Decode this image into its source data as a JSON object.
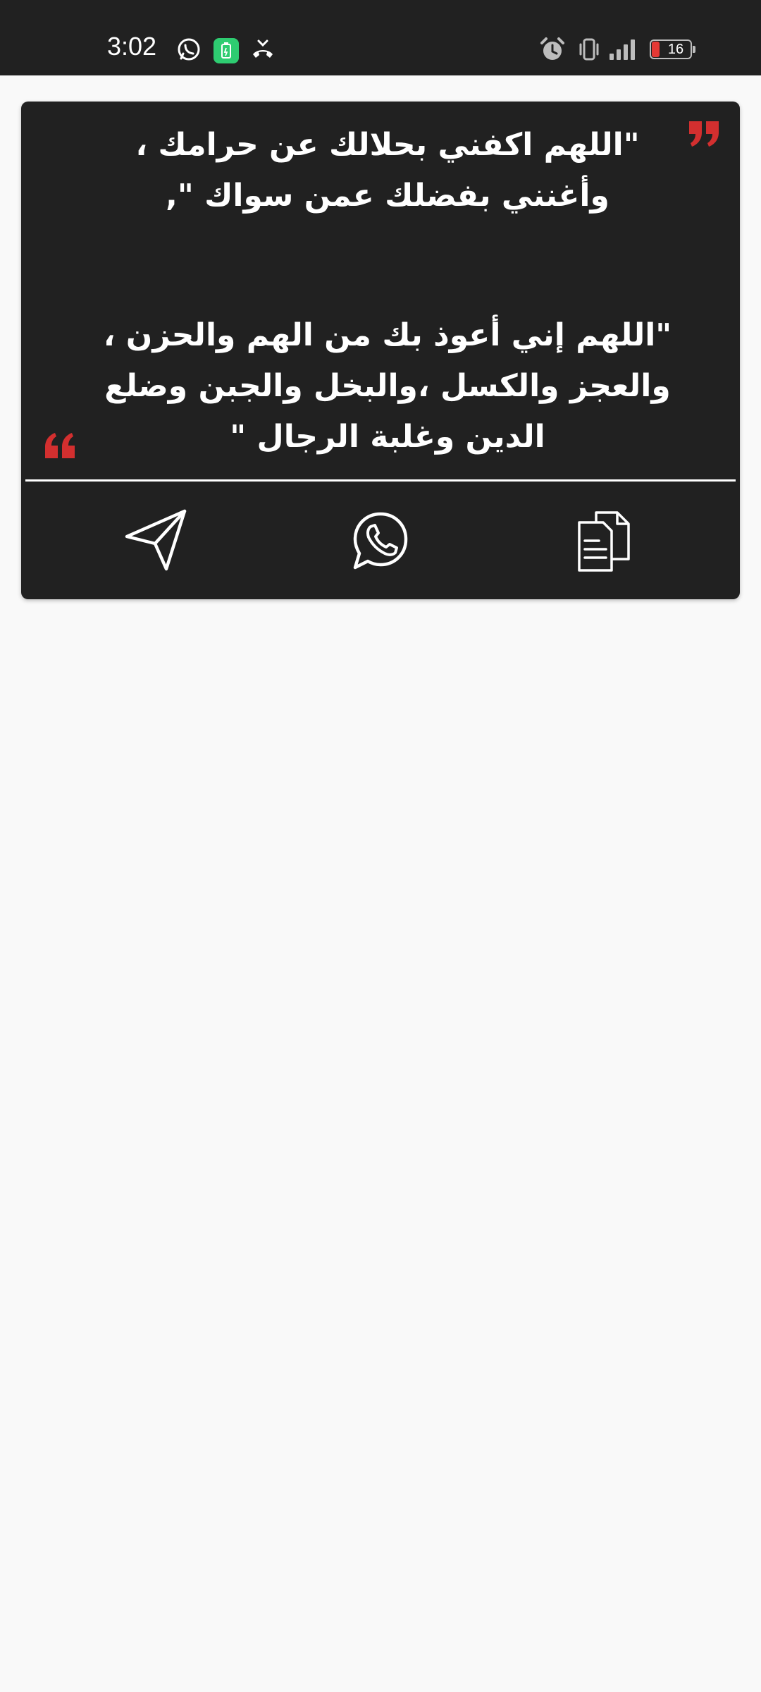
{
  "status_bar": {
    "time": "3:02",
    "battery_level": "16",
    "icons": [
      "whatsapp-icon",
      "battery-saver-icon",
      "missed-call-icon",
      "alarm-icon",
      "vibrate-icon",
      "signal-icon",
      "battery-icon"
    ]
  },
  "card": {
    "quotes": [
      "\"اللهم اكفني بحلالك عن حرامك ، وأغنني بفضلك عمن سواك \",",
      "\"اللهم إني أعوذ بك من الهم والحزن ، والعجز والكسل ،والبخل والجبن وضلع الدين وغلبة الرجال \""
    ],
    "actions": [
      "share-icon",
      "whatsapp-icon",
      "copy-icon"
    ]
  },
  "colors": {
    "status_bar_bg": "#212121",
    "card_bg": "#212121",
    "page_bg": "#f9f9f9",
    "quote_mark": "#d32f2f",
    "text": "#ffffff",
    "battery_saver_accent": "#2ecc71",
    "battery_low": "#e53935"
  }
}
